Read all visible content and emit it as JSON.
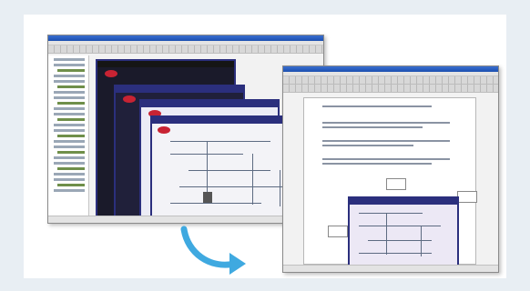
{
  "scene": {
    "description_type": "illustration",
    "colors": {
      "background": "#e8eef3",
      "card": "#ffffff",
      "titlebar": "#1c4fb0",
      "diagram_frame": "#2b2f7d",
      "logo": "#c82333",
      "arrow": "#3fa9e0"
    },
    "icons": {
      "arrow": "curved-arrow-icon",
      "logo": "red-oval-logo-icon"
    }
  }
}
